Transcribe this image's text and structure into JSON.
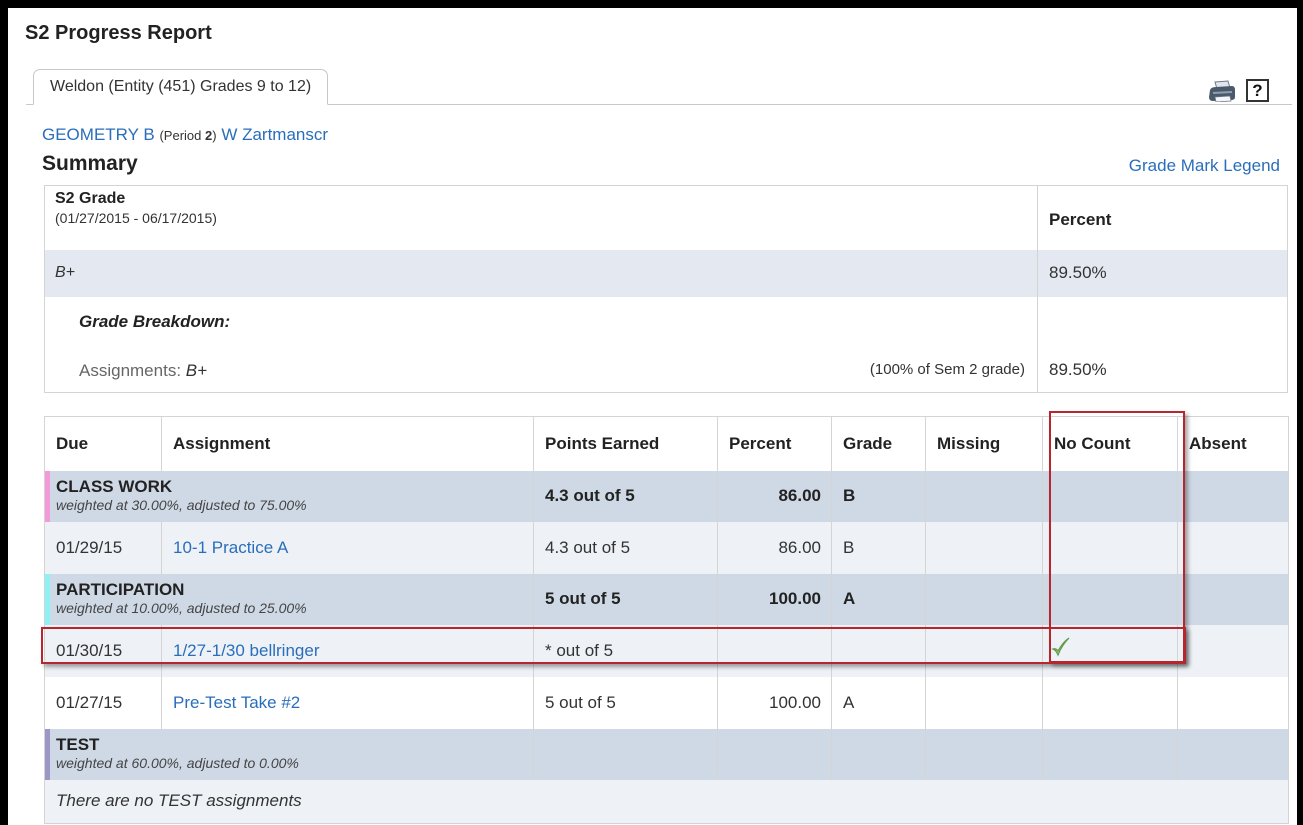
{
  "page": {
    "title": "S2 Progress Report"
  },
  "entity_tab": {
    "label": "Weldon (Entity (451) Grades 9 to 12)"
  },
  "toolbar": {
    "print_icon": "printer-icon",
    "help_label": "?"
  },
  "course": {
    "name": "GEOMETRY B",
    "period_prefix": "(Period ",
    "period": "2",
    "period_suffix": ")",
    "teacher": "W Zartmanscr"
  },
  "summary": {
    "heading": "Summary",
    "legend_link": "Grade Mark Legend",
    "grade_title": "S2 Grade",
    "date_range": "(01/27/2015 - 06/17/2015)",
    "percent_header": "Percent",
    "grade": "B+",
    "percent": "89.50%",
    "breakdown_label": "Grade Breakdown:",
    "assignments_label": "Assignments:",
    "assignments_grade": "B+",
    "assignments_weight": "(100% of Sem 2 grade)",
    "assignments_percent": "89.50%"
  },
  "table": {
    "headers": [
      "Due",
      "Assignment",
      "Points Earned",
      "Percent",
      "Grade",
      "Missing",
      "No Count",
      "Absent"
    ],
    "categories": [
      {
        "name": "CLASS WORK",
        "weight": "weighted at 30.00%, adjusted to 75.00%",
        "points": "4.3 out of 5",
        "percent": "86.00",
        "grade": "B",
        "color": "#f49ad9",
        "items": [
          {
            "due": "01/29/15",
            "assignment": "10-1 Practice A",
            "points": "4.3 out of 5",
            "percent": "86.00",
            "grade": "B",
            "missing": "",
            "no_count": false,
            "absent": ""
          }
        ]
      },
      {
        "name": "PARTICIPATION",
        "weight": "weighted at 10.00%, adjusted to 25.00%",
        "points": "5 out of 5",
        "percent": "100.00",
        "grade": "A",
        "color": "#8ef1f3",
        "items": [
          {
            "due": "01/30/15",
            "assignment": "1/27-1/30 bellringer",
            "points": "* out of 5",
            "percent": "",
            "grade": "",
            "missing": "",
            "no_count": true,
            "absent": ""
          },
          {
            "due": "01/27/15",
            "assignment": "Pre-Test Take #2",
            "points": "5 out of 5",
            "percent": "100.00",
            "grade": "A",
            "missing": "",
            "no_count": false,
            "absent": ""
          }
        ]
      },
      {
        "name": "TEST",
        "weight": "weighted at 60.00%, adjusted to 0.00%",
        "points": "",
        "percent": "",
        "grade": "",
        "color": "#9d97c8",
        "empty_message": "There are no TEST assignments",
        "items": []
      }
    ]
  },
  "colors": {
    "link": "#2a6ebb",
    "category_bg": "#cfd9e6",
    "highlight": "#b5262e",
    "check": "#7fb86a"
  }
}
